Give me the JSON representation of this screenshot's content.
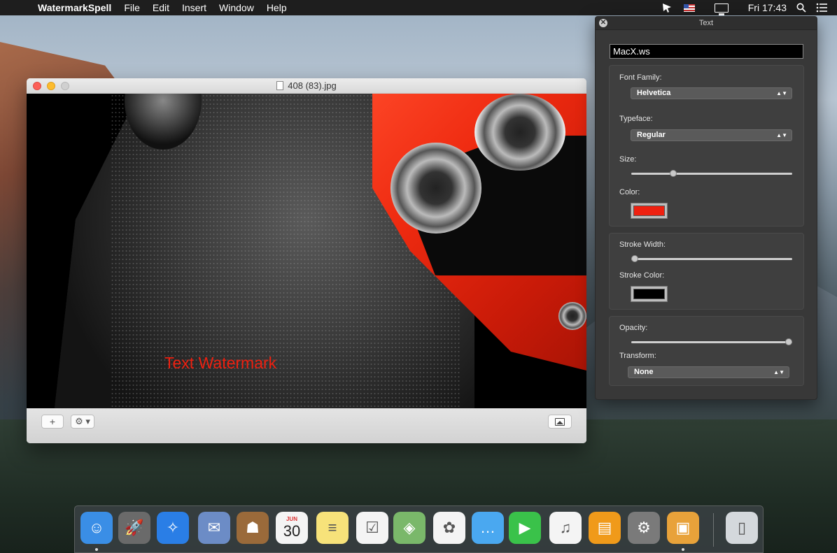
{
  "menubar": {
    "apple": "",
    "app_name": "WatermarkSpell",
    "menus": [
      "File",
      "Edit",
      "Insert",
      "Window",
      "Help"
    ],
    "clock": "Fri 17:43",
    "icons": [
      "cursor-icon",
      "us-flag-icon",
      "screen-mirror-icon",
      "spotlight-search-icon",
      "notification-center-icon"
    ]
  },
  "document_window": {
    "title": "408 (83).jpg",
    "watermark_text": "Text Watermark",
    "watermark_color": "#ee2010",
    "toolbar": {
      "add_label": "+",
      "gear_label": "⚙ ▾"
    }
  },
  "text_panel": {
    "title": "Text",
    "close_glyph": "✕",
    "text_value": "MacX.ws",
    "font_family_label": "Font Family:",
    "font_family_value": "Helvetica",
    "typeface_label": "Typeface:",
    "typeface_value": "Regular",
    "size_label": "Size:",
    "size_fraction": 0.25,
    "color_label": "Color:",
    "color_value": "#ee2010",
    "stroke_width_label": "Stroke Width:",
    "stroke_width_fraction": 0.0,
    "stroke_color_label": "Stroke Color:",
    "stroke_color_value": "#000000",
    "opacity_label": "Opacity:",
    "opacity_fraction": 1.0,
    "transform_label": "Transform:",
    "transform_value": "None",
    "select_arrows": "▲▼"
  },
  "dock": {
    "calendar_month": "JUN",
    "calendar_day": "30",
    "items": [
      {
        "name": "finder",
        "icon": "finder-icon",
        "color": "#3a8ee6",
        "running": true
      },
      {
        "name": "launchpad",
        "icon": "rocket-icon",
        "color": "#6a6a6a",
        "running": false
      },
      {
        "name": "safari",
        "icon": "compass-icon",
        "color": "#2a7ee6",
        "running": false
      },
      {
        "name": "mail",
        "icon": "eagle-stamp-icon",
        "color": "#6c8cc6",
        "running": false
      },
      {
        "name": "contacts",
        "icon": "contacts-book-icon",
        "color": "#9a6a3a",
        "running": false
      },
      {
        "name": "calendar",
        "icon": "calendar-icon",
        "color": "#f4f4f4",
        "running": false
      },
      {
        "name": "notes",
        "icon": "notepad-icon",
        "color": "#f7e27a",
        "running": false
      },
      {
        "name": "reminders",
        "icon": "checklist-icon",
        "color": "#f4f4f4",
        "running": false
      },
      {
        "name": "maps",
        "icon": "map-icon",
        "color": "#7ab86a",
        "running": false
      },
      {
        "name": "photos",
        "icon": "photos-flower-icon",
        "color": "#f4f4f4",
        "running": false
      },
      {
        "name": "messages",
        "icon": "speech-bubble-icon",
        "color": "#4aa8f0",
        "running": false
      },
      {
        "name": "facetime",
        "icon": "video-camera-icon",
        "color": "#3ac24a",
        "running": false
      },
      {
        "name": "itunes",
        "icon": "music-note-icon",
        "color": "#f4f4f4",
        "running": false
      },
      {
        "name": "ibooks",
        "icon": "open-book-icon",
        "color": "#f09a1a",
        "running": false
      },
      {
        "name": "system-preferences",
        "icon": "gear-icon",
        "color": "#7a7a7a",
        "running": false
      },
      {
        "name": "watermarkspell",
        "icon": "picture-frame-icon",
        "color": "#e8a23a",
        "running": true
      },
      {
        "name": "trash",
        "icon": "trash-icon",
        "color": "#d4d8dc",
        "running": false
      }
    ]
  }
}
